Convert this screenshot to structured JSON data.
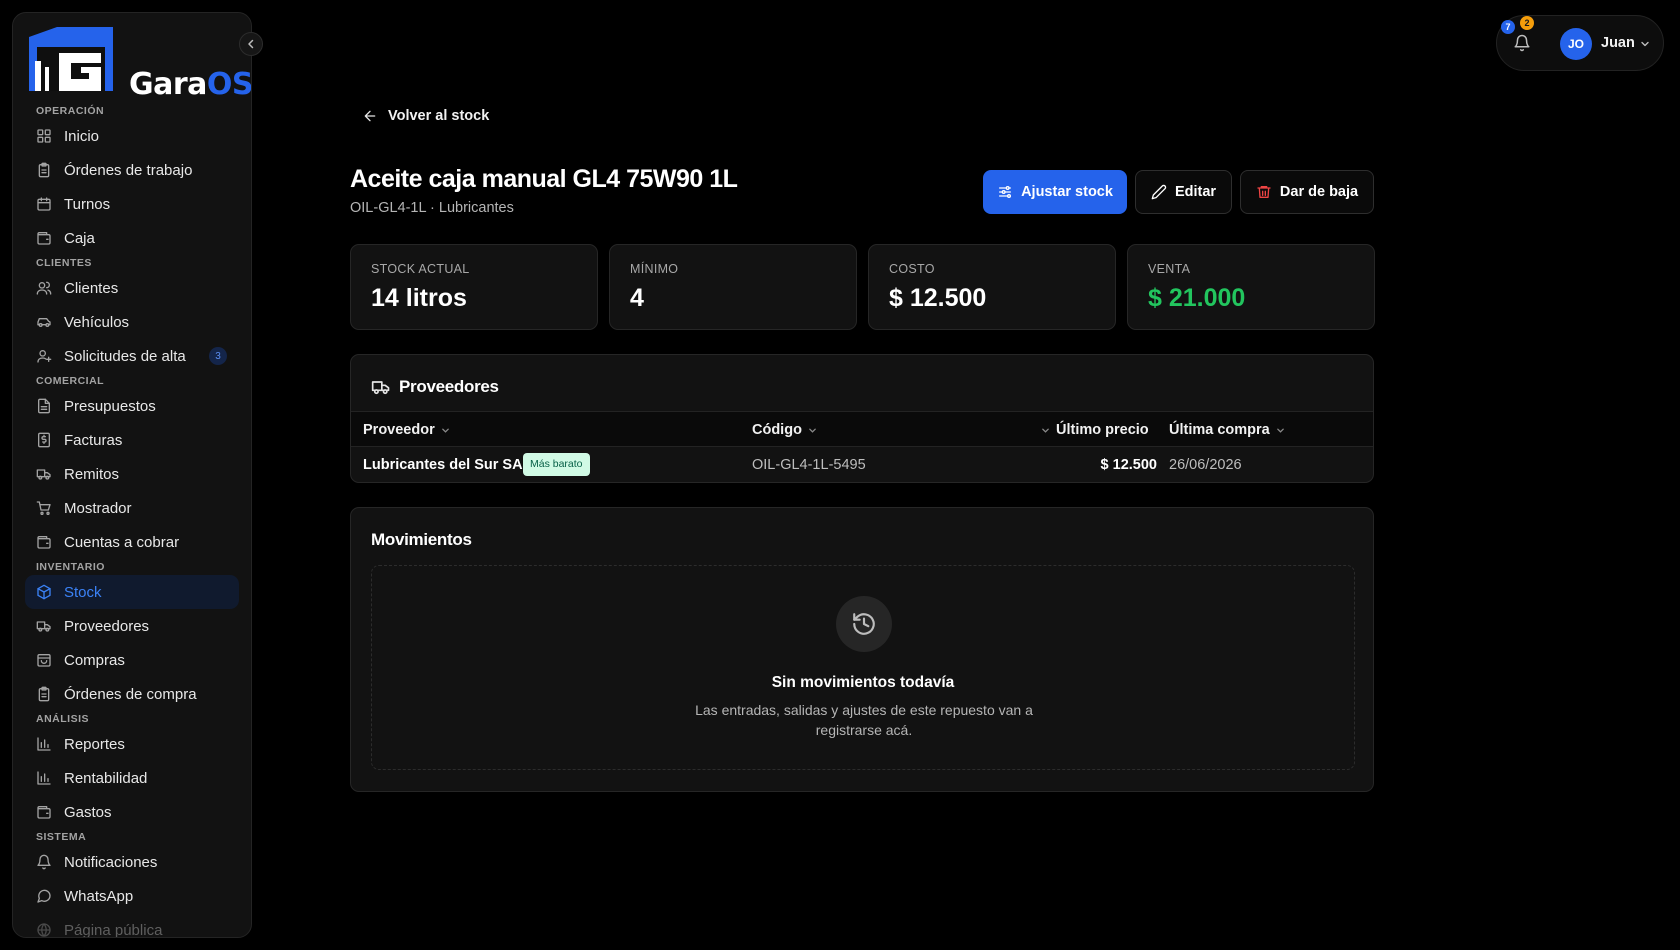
{
  "app": {
    "logo_text_part1": "Gara",
    "logo_text_part2": "OS",
    "brand_color": "#2563eb"
  },
  "sidebar": {
    "sections": [
      {
        "title": "OPERACIÓN",
        "items": [
          {
            "label": "Inicio",
            "icon": "grid-icon"
          },
          {
            "label": "Órdenes de trabajo",
            "icon": "clipboard-icon"
          },
          {
            "label": "Turnos",
            "icon": "calendar-icon"
          },
          {
            "label": "Caja",
            "icon": "wallet-icon"
          }
        ]
      },
      {
        "title": "CLIENTES",
        "items": [
          {
            "label": "Clientes",
            "icon": "users-icon"
          },
          {
            "label": "Vehículos",
            "icon": "car-icon"
          },
          {
            "label": "Solicitudes de alta",
            "icon": "user-plus-icon",
            "badge": "3"
          }
        ]
      },
      {
        "title": "COMERCIAL",
        "items": [
          {
            "label": "Presupuestos",
            "icon": "file-text-icon"
          },
          {
            "label": "Facturas",
            "icon": "receipt-icon"
          },
          {
            "label": "Remitos",
            "icon": "truck-icon"
          },
          {
            "label": "Mostrador",
            "icon": "cart-icon"
          },
          {
            "label": "Cuentas a cobrar",
            "icon": "wallet-icon"
          }
        ]
      },
      {
        "title": "INVENTARIO",
        "items": [
          {
            "label": "Stock",
            "icon": "package-icon",
            "active": true
          },
          {
            "label": "Proveedores",
            "icon": "truck-icon"
          },
          {
            "label": "Compras",
            "icon": "shopping-bag-icon"
          },
          {
            "label": "Órdenes de compra",
            "icon": "clipboard-icon"
          }
        ]
      },
      {
        "title": "ANÁLISIS",
        "items": [
          {
            "label": "Reportes",
            "icon": "bar-chart-icon"
          },
          {
            "label": "Rentabilidad",
            "icon": "bar-chart-icon"
          },
          {
            "label": "Gastos",
            "icon": "wallet-icon"
          }
        ]
      },
      {
        "title": "SISTEMA",
        "items": [
          {
            "label": "Notificaciones",
            "icon": "bell-icon"
          },
          {
            "label": "WhatsApp",
            "icon": "message-circle-icon"
          },
          {
            "label": "Página pública",
            "icon": "globe-icon",
            "faded": true
          }
        ]
      }
    ]
  },
  "topbar": {
    "notif_badge_blue": "7",
    "notif_badge_orange": "2",
    "avatar_initials": "JO",
    "user_name": "Juan"
  },
  "main": {
    "back_label": "Volver al stock",
    "title": "Aceite caja manual GL4 75W90 1L",
    "subtitle": "OIL-GL4-1L · Lubricantes",
    "actions": {
      "adjust_label": "Ajustar stock",
      "edit_label": "Editar",
      "delete_label": "Dar de baja"
    },
    "stats": [
      {
        "label": "STOCK ACTUAL",
        "value": "14 litros"
      },
      {
        "label": "MÍNIMO",
        "value": "4"
      },
      {
        "label": "COSTO",
        "value": "$ 12.500"
      },
      {
        "label": "VENTA",
        "value": "$ 21.000",
        "color": "#22c55e"
      }
    ],
    "suppliers": {
      "title": "Proveedores",
      "columns": [
        "Proveedor",
        "Código",
        "Último precio",
        "Última compra"
      ],
      "rows": [
        {
          "proveedor": "Lubricantes del Sur SA",
          "tag": "Más barato",
          "codigo": "OIL-GL4-1L-5495",
          "precio": "$ 12.500",
          "fecha": "26/06/2026"
        }
      ]
    },
    "movements": {
      "title": "Movimientos",
      "empty_title": "Sin movimientos todavía",
      "empty_desc": "Las entradas, salidas y ajustes de este repuesto van a registrarse acá."
    }
  }
}
